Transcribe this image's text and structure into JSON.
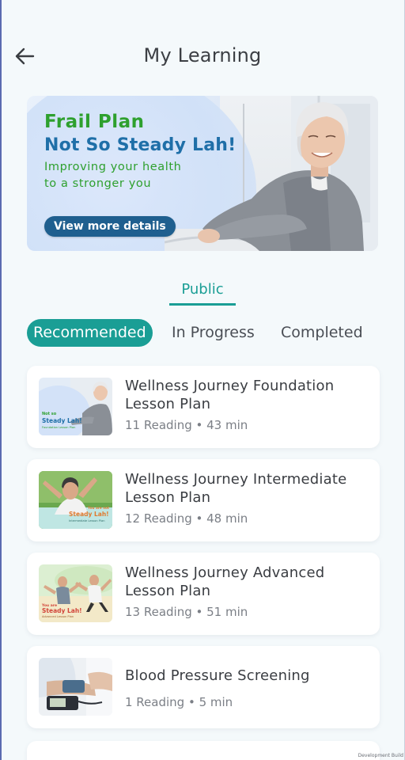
{
  "header": {
    "title": "My Learning",
    "back_icon": "arrow-left-icon"
  },
  "banner": {
    "line1": "Frail Plan",
    "line2": "Not So Steady Lah!",
    "line3": "Improving your  health\nto a stronger you",
    "cta": "View more details",
    "colors": {
      "green": "#2ea02e",
      "blue": "#1f6fa8",
      "cta_bg": "#1f5f8f"
    }
  },
  "scope_tab": {
    "label": "Public",
    "active": true
  },
  "filters": [
    {
      "label": "Recommended",
      "active": true
    },
    {
      "label": "In Progress",
      "active": false
    },
    {
      "label": "Completed",
      "active": false
    }
  ],
  "accent_color": "#1a9e95",
  "lessons": [
    {
      "title": "Wellness Journey Foundation Lesson Plan",
      "meta": "11 Reading • 43 min",
      "thumb": {
        "line1": "Not so",
        "line2": "Steady Lah!",
        "line3": "Foundation Lesson Plan"
      }
    },
    {
      "title": "Wellness Journey Intermediate Lesson Plan",
      "meta": "12 Reading • 48 min",
      "thumb": {
        "line1": "You are not",
        "line2": "Steady Lah!",
        "line3": "Intermediate Lesson Plan"
      }
    },
    {
      "title": "Wellness Journey Advanced Lesson Plan",
      "meta": "13 Reading • 51 min",
      "thumb": {
        "line1": "You are",
        "line2": "Steady Lah!",
        "line3": "Advanced Lesson Plan"
      }
    },
    {
      "title": "Blood Pressure Screening",
      "meta": "1 Reading • 5 min"
    }
  ],
  "watermark": "Development Build"
}
